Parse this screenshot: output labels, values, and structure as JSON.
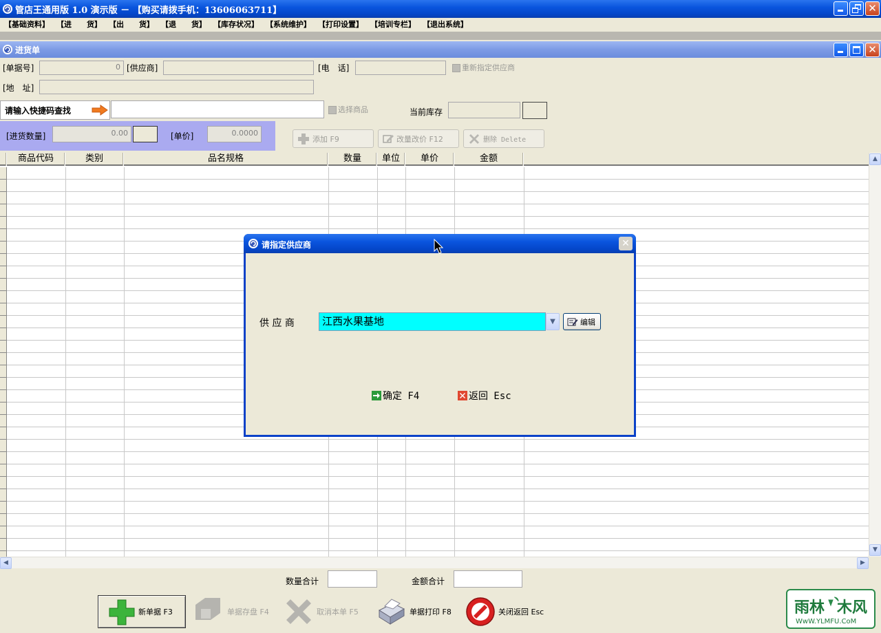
{
  "app": {
    "title": "管店王通用版 1.0 演示版 － 【购买请拨手机：13606063711】"
  },
  "menu": [
    "【基础资料】",
    "【进　　货】",
    "【出　　货】",
    "【退　　货】",
    "【库存状况】",
    "【系统维护】",
    "【打印设置】",
    "【培训专栏】",
    "【退出系统】"
  ],
  "window": {
    "title": "进货单"
  },
  "form": {
    "doc_no_label": "[单据号]",
    "doc_no_value": "0",
    "supplier_label": "[供应商]",
    "supplier_value": "",
    "phone_label": "[电　话]",
    "phone_value": "",
    "reassign_label": "重新指定供应商",
    "address_label": "[地　址]",
    "address_value": "",
    "quick_search_label": "请输入快捷码查找",
    "quick_search_value": "",
    "select_goods_label": "选择商品",
    "current_stock_label": "当前库存",
    "current_stock_value": "",
    "qty_label": "[进货数量]",
    "qty_value": "0.00",
    "price_label": "[单价]",
    "price_value": "0.0000"
  },
  "toolbar": {
    "add_label": "添加 F9",
    "modify_label": "改量改价 F12",
    "delete_label": "删除 Delete"
  },
  "grid": {
    "columns": [
      "商品代码",
      "类别",
      "品名规格",
      "数量",
      "单位",
      "单价",
      "金额"
    ],
    "rows": []
  },
  "totals": {
    "qty_total_label": "数量合计",
    "qty_total_value": "",
    "amount_total_label": "金额合计",
    "amount_total_value": ""
  },
  "bottom": {
    "new_label": "新单据 F3",
    "save_label": "单据存盘 F4",
    "cancel_label": "取消本单 F5",
    "print_label": "单据打印 F8",
    "close_label": "关闭返回 Esc"
  },
  "dialog": {
    "title": "请指定供应商",
    "supplier_label": "供 应 商",
    "supplier_value": "江西水果基地",
    "edit_label": "编辑",
    "ok_label": "确定 F4",
    "back_label": "返回 Esc"
  },
  "watermark": {
    "brand": "雨林木风",
    "url": "WwW.YLMFU.CoM"
  },
  "colors": {
    "title_blue": "#0a55de",
    "child_title": "#7d9be5",
    "qty_panel": "#aaaaf0",
    "combo_highlight": "#00ffff"
  }
}
